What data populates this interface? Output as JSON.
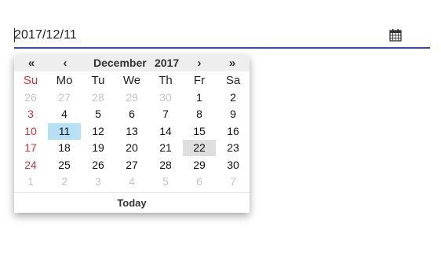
{
  "input": {
    "value": "2017/12/11",
    "icon": "calendar-icon"
  },
  "calendar": {
    "prev_year": "«",
    "prev_month": "‹",
    "month": "December",
    "year": "2017",
    "next_month": "›",
    "next_year": "»",
    "weekdays": [
      "Su",
      "Mo",
      "Tu",
      "We",
      "Th",
      "Fr",
      "Sa"
    ],
    "weeks": [
      [
        "26",
        "27",
        "28",
        "29",
        "30",
        "1",
        "2"
      ],
      [
        "3",
        "4",
        "5",
        "6",
        "7",
        "8",
        "9"
      ],
      [
        "10",
        "11",
        "12",
        "13",
        "14",
        "15",
        "16"
      ],
      [
        "17",
        "18",
        "19",
        "20",
        "21",
        "22",
        "23"
      ],
      [
        "24",
        "25",
        "26",
        "27",
        "28",
        "29",
        "30"
      ],
      [
        "1",
        "2",
        "3",
        "4",
        "5",
        "6",
        "7"
      ]
    ],
    "selected_day": "11",
    "today_day": "22",
    "today_label": "Today"
  },
  "colors": {
    "underline": "#3b4ba3",
    "sunday": "#d0343f",
    "muted": "#c4c4c4",
    "selected": "#b6e0f7",
    "today": "#dedede",
    "header_bg": "#eeeeee"
  }
}
